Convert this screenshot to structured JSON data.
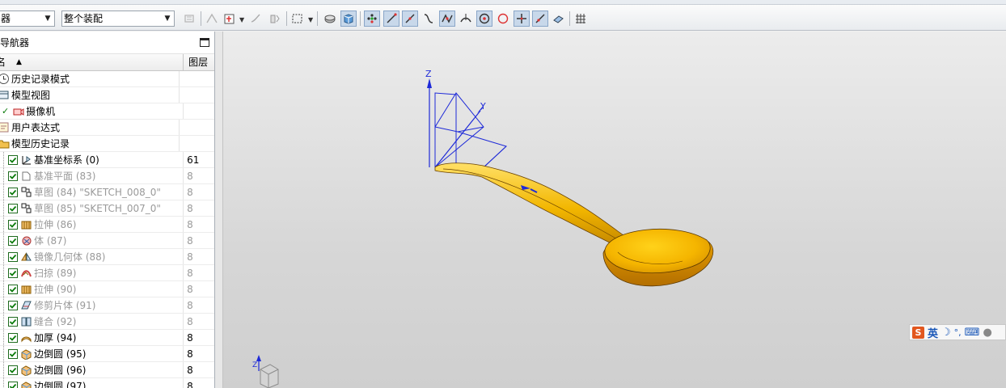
{
  "toolbar": {
    "filter_combo": "器",
    "assembly_combo": "整个装配",
    "buttons": [
      "snap-icon",
      "wire-icon",
      "component-icon",
      "move-icon",
      "view-icon",
      "select-box-icon",
      "shaded-edge-icon",
      "shaded-icon",
      "point-icon",
      "line-icon",
      "line-2-icon",
      "curve-icon",
      "spline-icon",
      "tangent-icon",
      "center-icon",
      "circle-icon",
      "plus-icon",
      "line-3-icon",
      "camera-icon",
      "grid-icon"
    ]
  },
  "navigator": {
    "title": "导航器",
    "header_name": "名",
    "header_layer": "图层",
    "rows": [
      {
        "label": "历史记录模式",
        "layer": "",
        "icon": "history-mode-icon",
        "indent": 0,
        "checked": false,
        "dim": false
      },
      {
        "label": "模型视图",
        "layer": "",
        "icon": "model-view-icon",
        "indent": 0,
        "checked": false,
        "dim": false
      },
      {
        "label": "摄像机",
        "layer": "",
        "icon": "camera-icon",
        "indent": 1,
        "checked": false,
        "dim": false
      },
      {
        "label": "用户表达式",
        "layer": "",
        "icon": "expression-icon",
        "indent": 0,
        "checked": false,
        "dim": false
      },
      {
        "label": "模型历史记录",
        "layer": "",
        "icon": "folder-icon",
        "indent": 0,
        "checked": false,
        "dim": false
      },
      {
        "label": "基准坐标系 (0)",
        "layer": "61",
        "icon": "datum-csys-icon",
        "indent": 2,
        "checked": true,
        "dim": false
      },
      {
        "label": "基准平面 (83)",
        "layer": "8",
        "icon": "datum-plane-icon",
        "indent": 2,
        "checked": true,
        "dim": true
      },
      {
        "label": "草图 (84) \"SKETCH_008_0\"",
        "layer": "8",
        "icon": "sketch-icon",
        "indent": 2,
        "checked": true,
        "dim": true
      },
      {
        "label": "草图 (85) \"SKETCH_007_0\"",
        "layer": "8",
        "icon": "sketch-icon",
        "indent": 2,
        "checked": true,
        "dim": true
      },
      {
        "label": "拉伸 (86)",
        "layer": "8",
        "icon": "extrude-icon",
        "indent": 2,
        "checked": true,
        "dim": true
      },
      {
        "label": "体 (87)",
        "layer": "8",
        "icon": "body-icon",
        "indent": 2,
        "checked": true,
        "dim": true
      },
      {
        "label": "镜像几何体 (88)",
        "layer": "8",
        "icon": "mirror-icon",
        "indent": 2,
        "checked": true,
        "dim": true
      },
      {
        "label": "扫掠 (89)",
        "layer": "8",
        "icon": "sweep-icon",
        "indent": 2,
        "checked": true,
        "dim": true
      },
      {
        "label": "拉伸 (90)",
        "layer": "8",
        "icon": "extrude-icon",
        "indent": 2,
        "checked": true,
        "dim": true
      },
      {
        "label": "修剪片体 (91)",
        "layer": "8",
        "icon": "trim-sheet-icon",
        "indent": 2,
        "checked": true,
        "dim": true
      },
      {
        "label": "缝合 (92)",
        "layer": "8",
        "icon": "sew-icon",
        "indent": 2,
        "checked": true,
        "dim": true
      },
      {
        "label": "加厚 (94)",
        "layer": "8",
        "icon": "thicken-icon",
        "indent": 2,
        "checked": true,
        "dim": false
      },
      {
        "label": "边倒圆 (95)",
        "layer": "8",
        "icon": "edge-blend-icon",
        "indent": 2,
        "checked": true,
        "dim": false
      },
      {
        "label": "边倒圆 (96)",
        "layer": "8",
        "icon": "edge-blend-icon",
        "indent": 2,
        "checked": true,
        "dim": false
      },
      {
        "label": "边倒圆 (97)",
        "layer": "8",
        "icon": "edge-blend-icon",
        "indent": 2,
        "checked": true,
        "dim": false
      }
    ]
  },
  "viewport": {
    "csys_labels": {
      "z": "Z",
      "y": "Y",
      "x": "X"
    },
    "mini_triad_label": "Z",
    "model_color": "#e8a800"
  },
  "ime": {
    "logo": "S",
    "mode": "英"
  }
}
